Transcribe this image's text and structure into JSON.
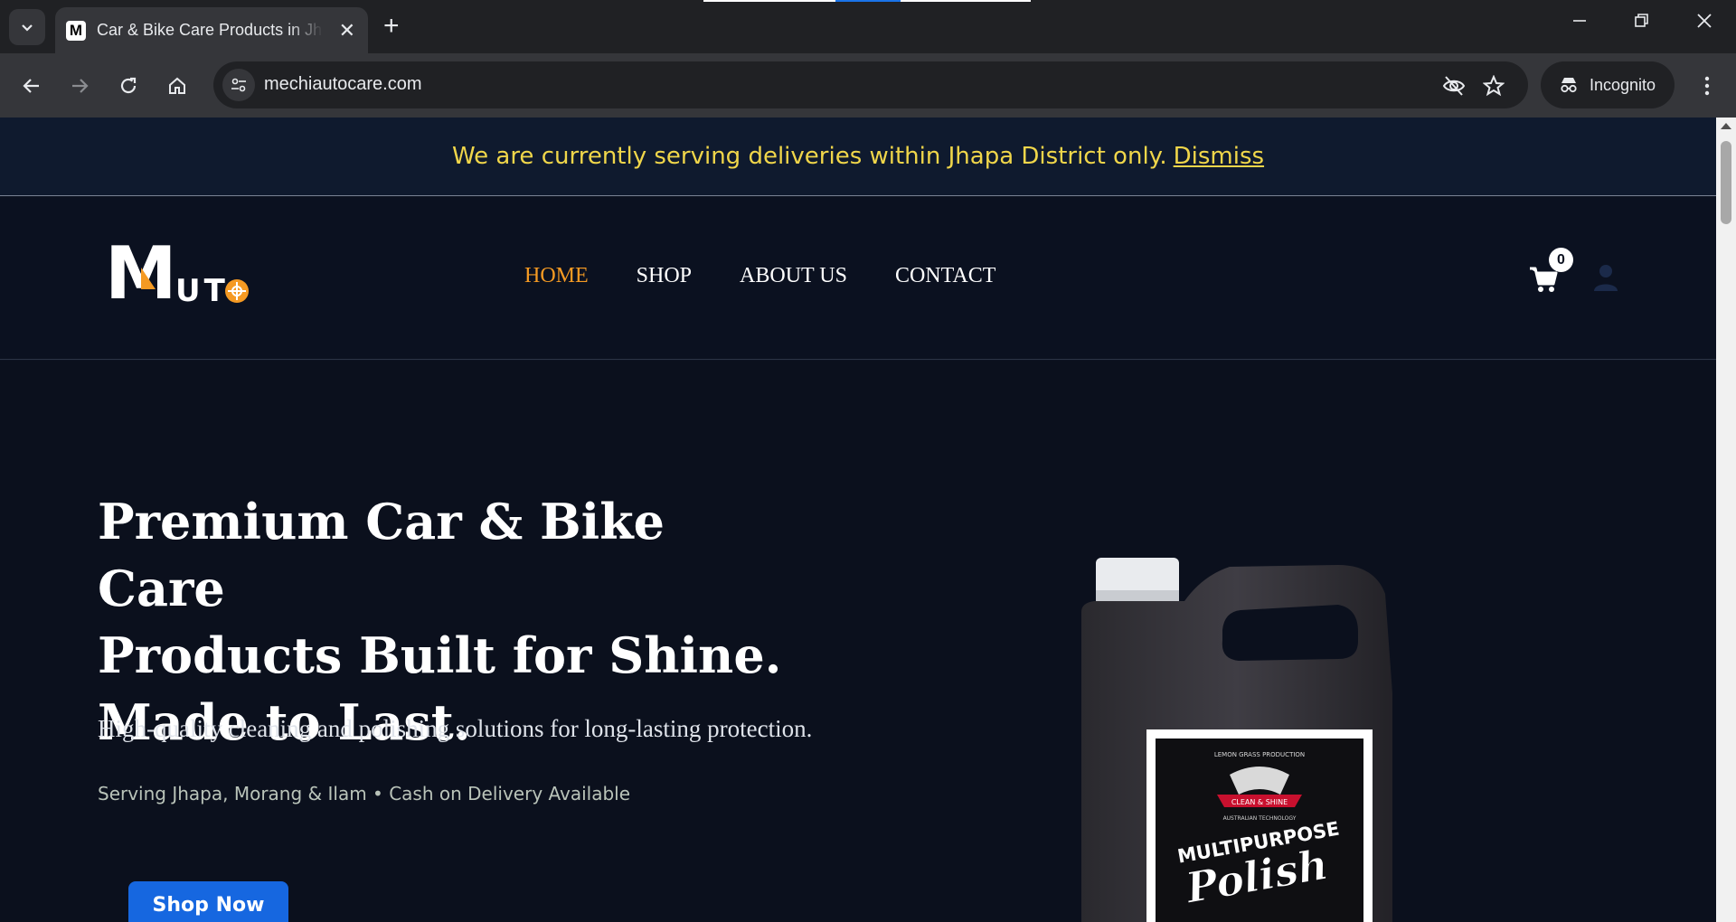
{
  "browser": {
    "tab_title": "Car & Bike Care Products in Jhapa",
    "favicon_letter": "M",
    "url": "mechiautocare.com",
    "profile_label": "Incognito"
  },
  "notice": {
    "text": "We are currently serving deliveries within Jhapa District only.",
    "dismiss_label": "Dismiss"
  },
  "header": {
    "logo_text": "MUTO",
    "nav": [
      "HOME",
      "SHOP",
      "ABOUT US",
      "CONTACT"
    ],
    "active_nav": "HOME",
    "cart_count": "0"
  },
  "hero": {
    "title_lines": [
      "Premium Car & Bike Care",
      "Products Built for Shine.",
      "Made to Last."
    ],
    "subtitle": "High-quality cleaning and polishing solutions for long-lasting protection.",
    "meta": "Serving Jhapa, Morang & Ilam • Cash on Delivery Available",
    "cta_label": "Shop Now"
  },
  "product_label": {
    "maker": "LEMON GRASS PRODUCTION",
    "ribbon": "CLEAN & SHINE",
    "tech": "AUSTRALIAN TECHNOLOGY",
    "line1": "MULTIPURPOSE",
    "line2": "Polish"
  },
  "colors": {
    "accent": "#f59a23",
    "notice_text": "#f0d64a",
    "cta": "#1667e0",
    "background": "#0b101d"
  }
}
